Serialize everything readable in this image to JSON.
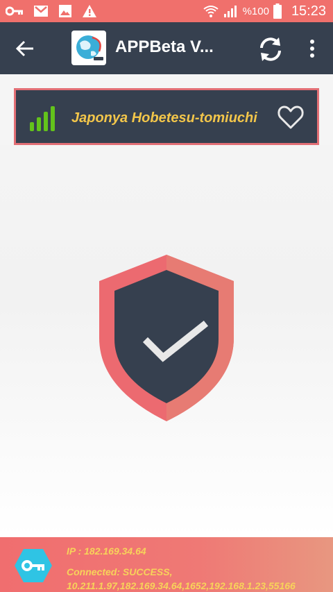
{
  "status_bar": {
    "battery_text": "%100",
    "time": "15:23",
    "left_icons": [
      "key-icon",
      "gmail-icon",
      "image-icon",
      "warning-icon"
    ],
    "right_icons": [
      "wifi-icon",
      "signal-icon",
      "battery-icon"
    ]
  },
  "app_bar": {
    "title": "APPBeta V...",
    "back_icon": "arrow-left-icon",
    "refresh_icon": "refresh-icon",
    "more_icon": "more-vert-icon"
  },
  "server": {
    "name": "Japonya Hobetesu-tomiuchi",
    "signal_icon": "signal-bars-icon",
    "favorite_icon": "heart-outline-icon"
  },
  "connection": {
    "shield_icon": "shield-check-icon"
  },
  "footer": {
    "ip_line": "IP : 182.169.34.64",
    "status_line": "Connected: SUCCESS,",
    "ips_line": "10.211.1.97,182.169.34.64,1652,192.168.1.23,55166",
    "key_icon": "key-icon"
  },
  "colors": {
    "accent": "#f0706c",
    "dark": "#36404f",
    "highlight": "#f3c64a",
    "signal_green": "#63c31b"
  }
}
